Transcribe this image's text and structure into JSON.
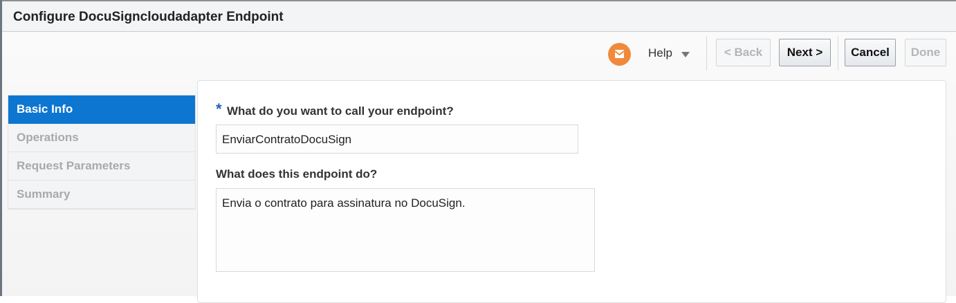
{
  "window": {
    "title": "Configure DocuSigncloudadapter Endpoint"
  },
  "toolbar": {
    "help_label": "Help",
    "back_label": "< Back",
    "next_label": "Next >",
    "cancel_label": "Cancel",
    "done_label": "Done",
    "help_icon": "support-icon",
    "accent": "#f08a3a"
  },
  "train": {
    "items": [
      {
        "label": "Basic Info",
        "selected": true
      },
      {
        "label": "Operations",
        "selected": false
      },
      {
        "label": "Request Parameters",
        "selected": false
      },
      {
        "label": "Summary",
        "selected": false
      }
    ],
    "selected_color": "#0d76d1"
  },
  "form": {
    "required_marker": "*",
    "name_label": "What do you want to call your endpoint?",
    "name_value": "EnviarContratoDocuSign",
    "description_label": "What does this endpoint do?",
    "description_value": "Envia o contrato para assinatura no DocuSign."
  }
}
